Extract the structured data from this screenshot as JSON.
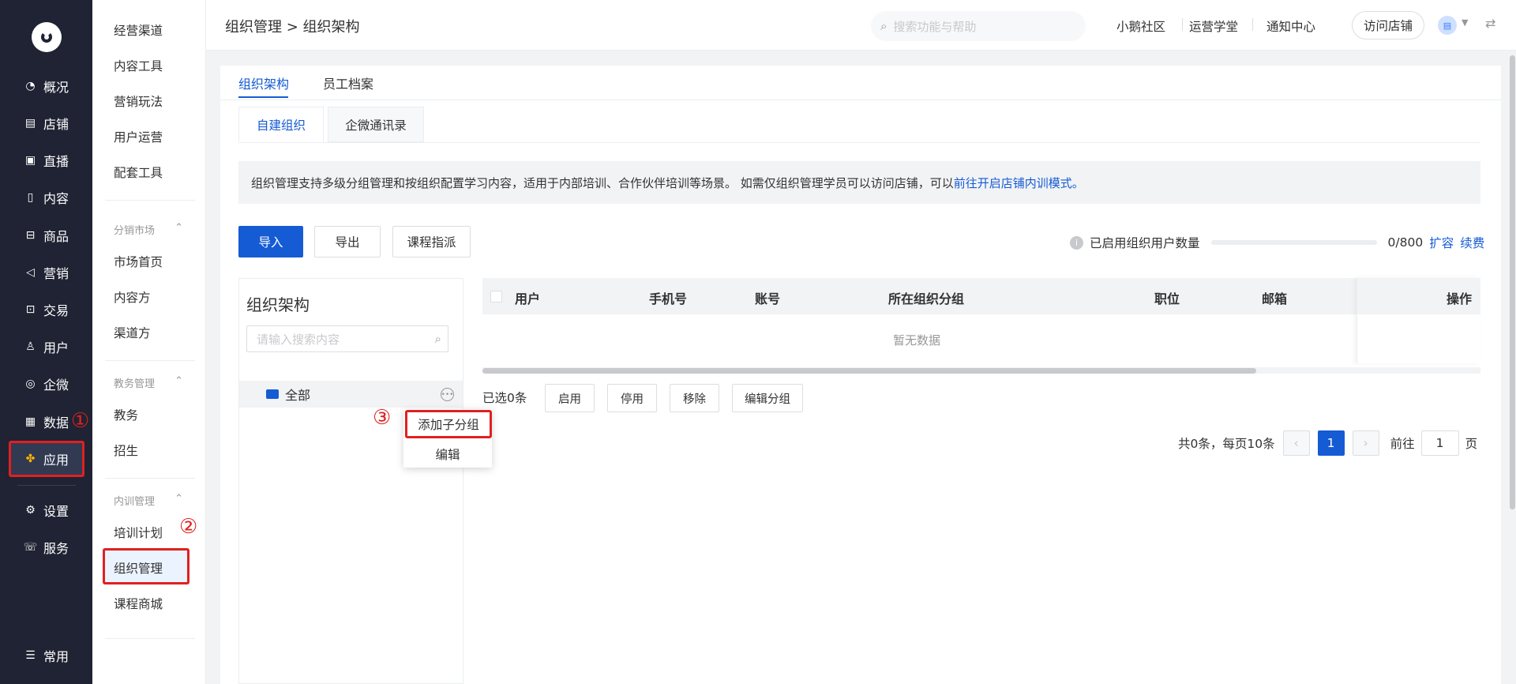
{
  "nav_primary": [
    {
      "label": "概况",
      "icon": "chart-pie-icon"
    },
    {
      "label": "店铺",
      "icon": "store-icon"
    },
    {
      "label": "直播",
      "icon": "live-icon"
    },
    {
      "label": "内容",
      "icon": "document-icon"
    },
    {
      "label": "商品",
      "icon": "goods-icon"
    },
    {
      "label": "营销",
      "icon": "megaphone-icon"
    },
    {
      "label": "交易",
      "icon": "trade-icon"
    },
    {
      "label": "用户",
      "icon": "user-icon"
    },
    {
      "label": "企微",
      "icon": "chat-icon"
    },
    {
      "label": "数据",
      "icon": "data-icon"
    },
    {
      "label": "应用",
      "icon": "apps-icon"
    },
    {
      "label": "设置",
      "icon": "gear-icon"
    },
    {
      "label": "服务",
      "icon": "service-icon"
    },
    {
      "label": "常用",
      "icon": "list-icon"
    }
  ],
  "nav_secondary": {
    "items_top": [
      "经营渠道",
      "内容工具",
      "营销玩法",
      "用户运营",
      "配套工具"
    ],
    "group1": {
      "title": "分销市场",
      "items": [
        "市场首页",
        "内容方",
        "渠道方"
      ]
    },
    "group2": {
      "title": "教务管理",
      "items": [
        "教务",
        "招生"
      ]
    },
    "group3": {
      "title": "内训管理",
      "items": [
        "培训计划",
        "组织管理",
        "课程商城"
      ]
    }
  },
  "header": {
    "breadcrumb": "组织管理 > 组织架构",
    "search_placeholder": "搜索功能与帮助",
    "links": [
      "小鹅社区",
      "运营学堂",
      "通知中心"
    ],
    "visit_store": "访问店铺"
  },
  "tabs": [
    "组织架构",
    "员工档案"
  ],
  "subtabs": [
    "自建组织",
    "企微通讯录"
  ],
  "notice": {
    "text": "组织管理支持多级分组管理和按组织配置学习内容，适用于内部培训、合作伙伴培训等场景。 如需仅组织管理学员可以访问店铺，可以 ",
    "link": "前往开启店铺内训模式。"
  },
  "toolbar": {
    "import": "导入",
    "export": "导出",
    "assign": "课程指派"
  },
  "quota": {
    "label": "已启用组织用户数量",
    "value": "0/800",
    "used": 0,
    "total": 800,
    "expand": "扩容",
    "renew": "续费"
  },
  "tree": {
    "title": "组织架构",
    "search_placeholder": "请输入搜索内容",
    "root": "全部",
    "menu_add": "添加子分组",
    "menu_edit": "编辑"
  },
  "table": {
    "columns": [
      "用户",
      "手机号",
      "账号",
      "所在组织分组",
      "职位",
      "邮箱",
      "操作"
    ],
    "empty": "暂无数据",
    "selected": "已选0条",
    "actions": [
      "启用",
      "停用",
      "移除",
      "编辑分组"
    ]
  },
  "pager": {
    "summary": "共0条，每页10条",
    "current": "1",
    "goto_label": "前往",
    "goto_value": "1",
    "page_unit": "页"
  },
  "markers": [
    "①",
    "②",
    "③"
  ],
  "colors": {
    "primary": "#155bd4",
    "highlight": "#e02020",
    "nav_bg": "#1f2333"
  }
}
